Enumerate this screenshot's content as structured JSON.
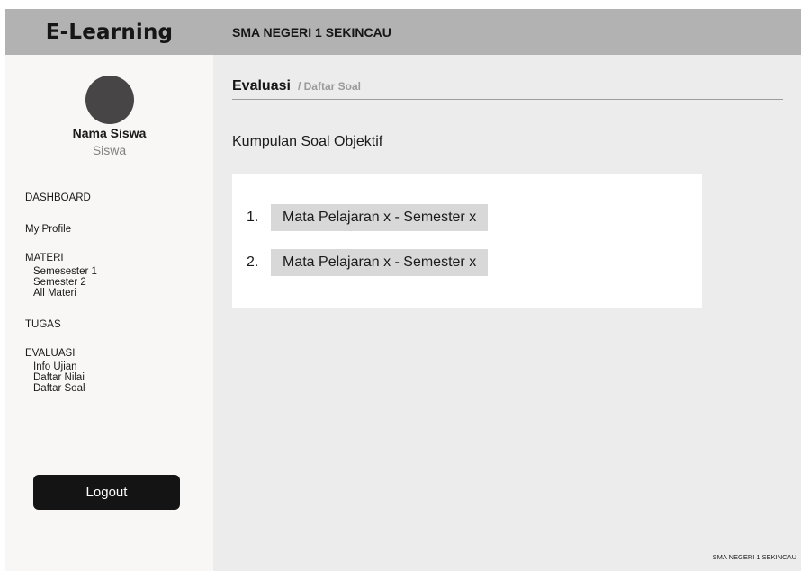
{
  "header": {
    "brand": "E-Learning",
    "school": "SMA NEGERI 1 SEKINCAU"
  },
  "user": {
    "name": "Nama Siswa",
    "role": "Siswa"
  },
  "nav": {
    "dashboard": "DASHBOARD",
    "profile": "My Profile",
    "materi": "MATERI",
    "materi_items": [
      "Semesester 1",
      "Semester 2",
      "All Materi"
    ],
    "tugas": "TUGAS",
    "evaluasi": "EVALUASI",
    "evaluasi_items": [
      "Info Ujian",
      "Daftar Nilai",
      "Daftar Soal"
    ],
    "logout": "Logout"
  },
  "breadcrumb": {
    "title": "Evaluasi",
    "sub": "/ Daftar Soal"
  },
  "main": {
    "section_title": "Kumpulan Soal Objektif",
    "items": [
      {
        "num": "1.",
        "label": "Mata Pelajaran x - Semester x"
      },
      {
        "num": "2.",
        "label": "Mata Pelajaran x - Semester x"
      }
    ],
    "footer": "SMA NEGERI 1 SEKINCAU"
  }
}
